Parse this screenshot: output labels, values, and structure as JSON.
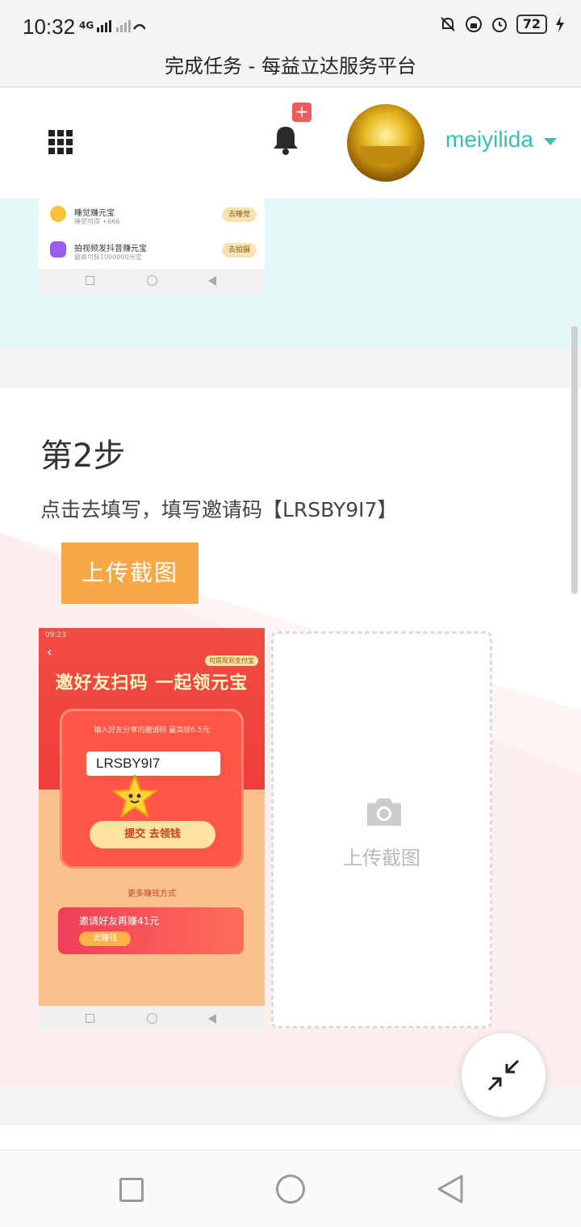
{
  "status_bar": {
    "time": "10:32",
    "network": "4G",
    "battery": "72"
  },
  "window": {
    "title": "完成任务 - 每益立达服务平台"
  },
  "header": {
    "badge": "+",
    "username": "meiyilida"
  },
  "step1_screenshot": {
    "rows": [
      {
        "title": "睡觉赚元宝",
        "subtitle": "睡觉可得 +666",
        "button": "去睡觉",
        "icon": "moon-icon",
        "color": "#f6c23e"
      },
      {
        "title": "拍视频发抖音赚元宝",
        "subtitle": "最高可获1000000元宝",
        "button": "去拍摄",
        "icon": "video-icon",
        "color": "#9b5cf0"
      }
    ]
  },
  "step2": {
    "title": "第2步",
    "description": "点击去填写，填写邀请码【LRSBY9I7】",
    "upload_button": "上传截图",
    "screenshot": {
      "status": "09:23",
      "tag": "可提现到支付宝",
      "headline": "邀好友扫码 一起领元宝",
      "panel_text": "输入好友分享的邀请码 最高领6.5元",
      "invite_code": "LRSBY9I7",
      "submit": "提交 去领钱",
      "more": "更多赚钱方式",
      "banner_title": "邀请好友再赚41元",
      "banner_button": "去赚钱"
    },
    "uploader_label": "上传截图"
  },
  "colors": {
    "teal": "#34c0b5",
    "orange": "#f5a845",
    "badge_red": "#ef5b5b"
  }
}
